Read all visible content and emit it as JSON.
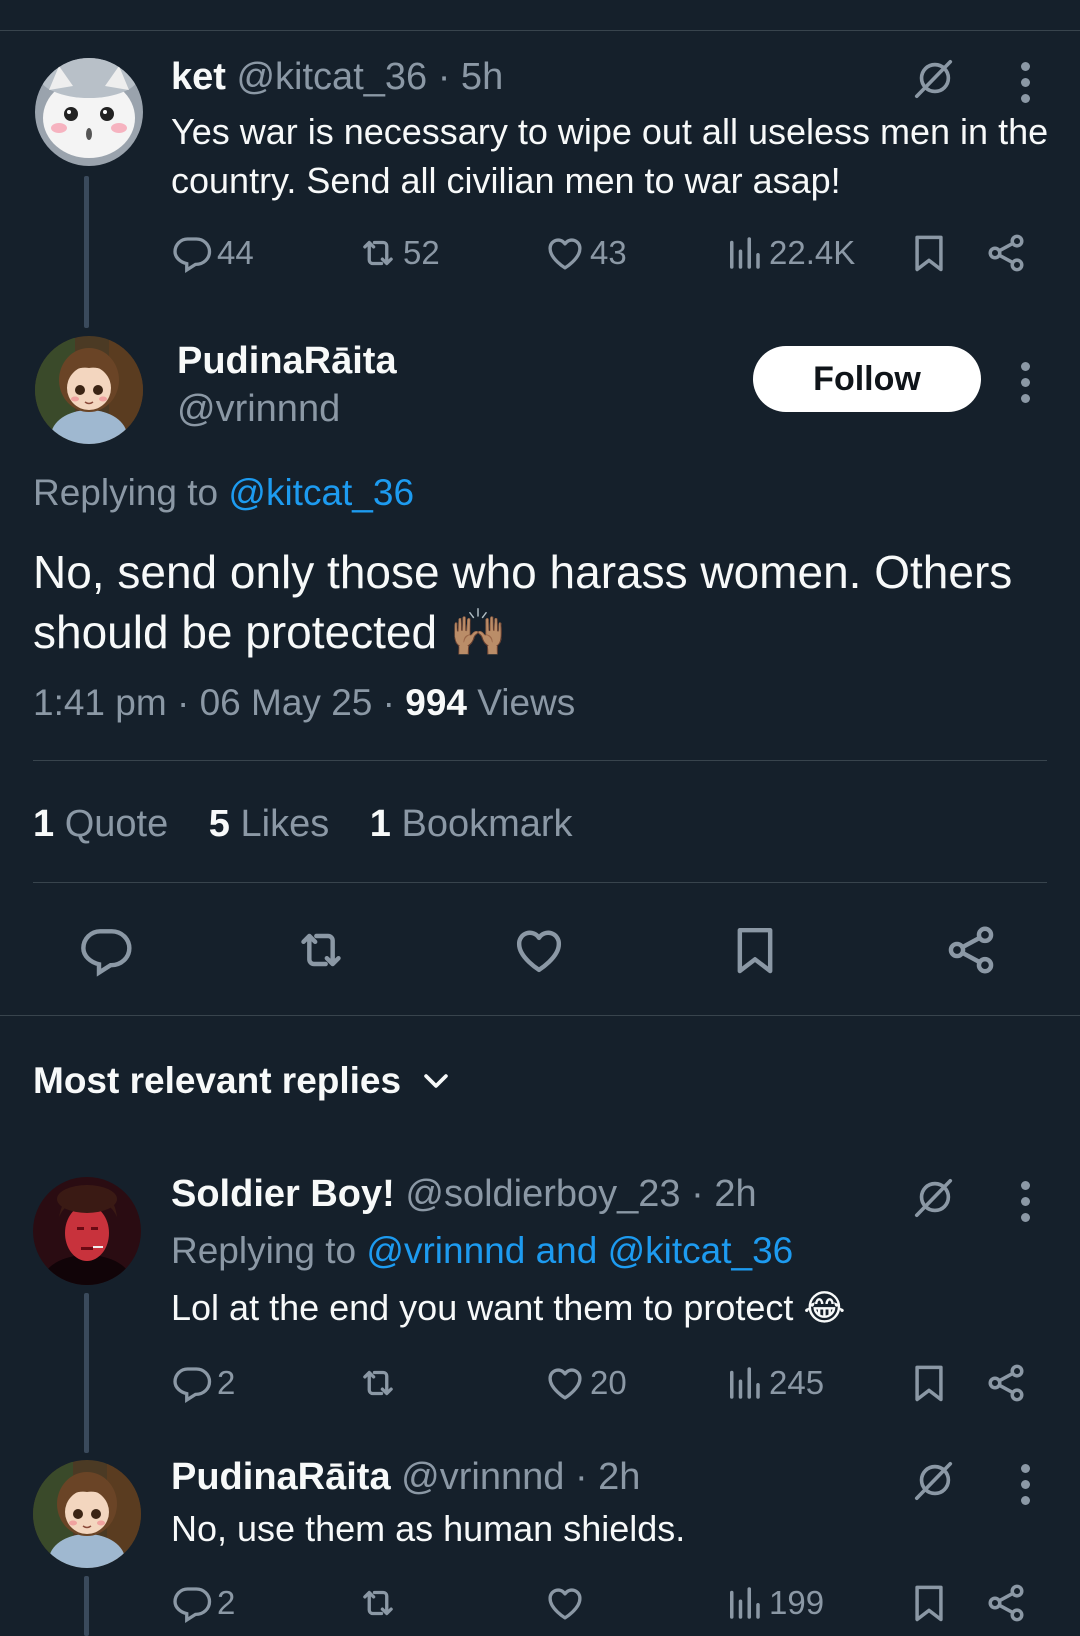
{
  "tweet1": {
    "name": "ket",
    "handle": "@kitcat_36",
    "time": "· 5h",
    "text": "Yes war is necessary to wipe out all useless men in the country. Send all civilian men to war asap!",
    "replies": "44",
    "reposts": "52",
    "likes": "43",
    "views": "22.4K"
  },
  "main": {
    "name": "PudinaRāita",
    "handle": "@vrinnnd",
    "follow_label": "Follow",
    "replying_prefix": "Replying to",
    "replying_to": "@kitcat_36",
    "text": "No, send only those who harass women. Others should be protected",
    "emoji": "🙌🏽",
    "time": "1:41 pm",
    "date": "06 May 25",
    "views_count": "994",
    "views_label": "Views",
    "quote_count": "1",
    "quote_label": "Quote",
    "likes_count": "5",
    "likes_label": "Likes",
    "bookmark_count": "1",
    "bookmark_label": "Bookmark"
  },
  "replies_header": "Most relevant replies",
  "reply1": {
    "name": "Soldier Boy!",
    "handle": "@soldierboy_23",
    "time": "· 2h",
    "replying_prefix": "Replying to",
    "replying_to": "@vrinnnd and @kitcat_36",
    "text": "Lol at the end you want them to protect",
    "emoji": "😂",
    "replies": "2",
    "reposts": "",
    "likes": "20",
    "views": "245"
  },
  "reply2": {
    "name": "PudinaRāita",
    "handle": "@vrinnnd",
    "time": "· 2h",
    "text": "No, use them as human shields.",
    "replies": "2",
    "reposts": "",
    "likes": "",
    "views": "199"
  },
  "colors": {
    "background": "#15202b",
    "text": "#f7f9f9",
    "muted": "#8b98a5",
    "link": "#1d9bf0",
    "divider": "#38444d"
  }
}
